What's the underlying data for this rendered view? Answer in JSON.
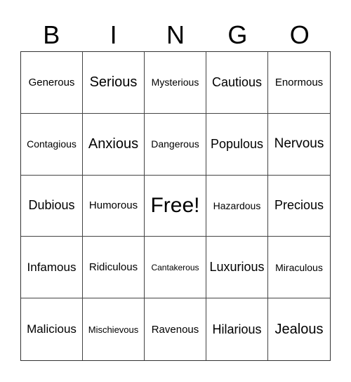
{
  "header": [
    "B",
    "I",
    "N",
    "G",
    "O"
  ],
  "cells": [
    [
      "Generous",
      "Serious",
      "Mysterious",
      "Cautious",
      "Enormous"
    ],
    [
      "Contagious",
      "Anxious",
      "Dangerous",
      "Populous",
      "Nervous"
    ],
    [
      "Dubious",
      "Humorous",
      "Free!",
      "Hazardous",
      "Precious"
    ],
    [
      "Infamous",
      "Ridiculous",
      "Cantakerous",
      "Luxurious",
      "Miraculous"
    ],
    [
      "Malicious",
      "Mischievous",
      "Ravenous",
      "Hilarious",
      "Jealous"
    ]
  ]
}
